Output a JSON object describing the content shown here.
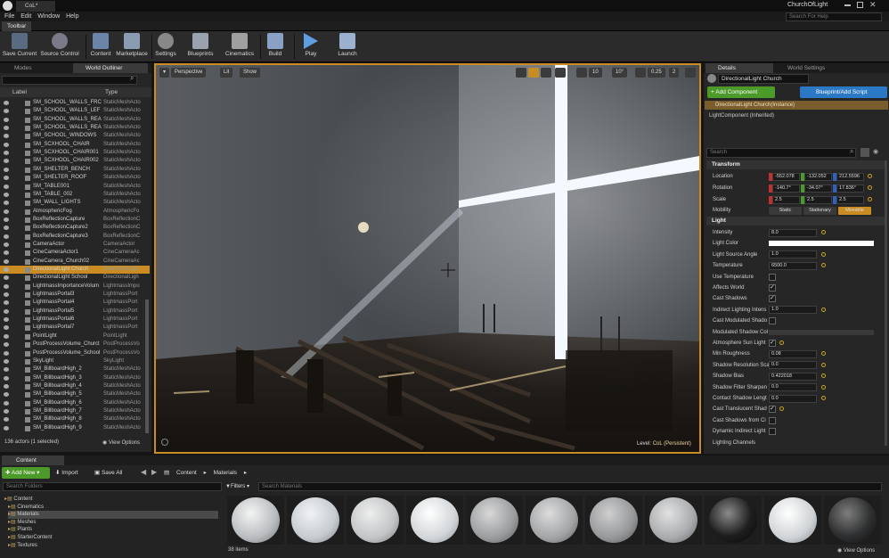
{
  "window": {
    "title": "CoL*",
    "project": "ChurchOfLight",
    "help_search_placeholder": "Search For Help"
  },
  "menu": [
    "File",
    "Edit",
    "Window",
    "Help"
  ],
  "toolbar": {
    "tab_label": "Toolbar",
    "buttons": [
      "Save Current",
      "Source Control",
      "Content",
      "Marketplace",
      "Settings",
      "Blueprints",
      "Cinematics",
      "Build",
      "Play",
      "Launch"
    ]
  },
  "left_panel": {
    "tabs": [
      "Modes",
      "World Outliner"
    ],
    "columns": {
      "label": "Label",
      "type": "Type"
    },
    "rows": [
      [
        "SM_SCHOOL_WALLS_FRC",
        "StaticMeshActo"
      ],
      [
        "SM_SCHOOL_WALLS_LEF",
        "StaticMeshActo"
      ],
      [
        "SM_SCHOOL_WALLS_REA",
        "StaticMeshActo"
      ],
      [
        "SM_SCHOOL_WALLS_REA",
        "StaticMeshActo"
      ],
      [
        "SM_SCHOOL_WINDOWS",
        "StaticMeshActo"
      ],
      [
        "SM_SCXHOOL_CHAIR",
        "StaticMeshActo"
      ],
      [
        "SM_SCXHOOL_CHAIR001",
        "StaticMeshActo"
      ],
      [
        "SM_SCXHOOL_CHAIR002",
        "StaticMeshActo"
      ],
      [
        "SM_SHELTER_BENCH",
        "StaticMeshActo"
      ],
      [
        "SM_SHELTER_ROOF",
        "StaticMeshActo"
      ],
      [
        "SM_TABLE001",
        "StaticMeshActo"
      ],
      [
        "SM_TABLE_002",
        "StaticMeshActo"
      ],
      [
        "SM_WALL_LIGHTS",
        "StaticMeshActo"
      ],
      [
        "AtmosphericFog",
        "AtmosphericFo"
      ],
      [
        "BoxReflectionCapture",
        "BoxReflectionC"
      ],
      [
        "BoxReflectionCapture2",
        "BoxReflectionC"
      ],
      [
        "BoxReflectionCapture3",
        "BoxReflectionC"
      ],
      [
        "CameraActor",
        "CameraActor"
      ],
      [
        "CineCameraActor1",
        "CineCameraAc"
      ],
      [
        "CineCamera_Church02",
        "CineCameraAc"
      ],
      [
        "DirectionalLight Church",
        "DirectionalLigh"
      ],
      [
        "DirectionalLight School",
        "DirectionalLigh"
      ],
      [
        "LightmassImportanceVolum",
        "LightmassImpo"
      ],
      [
        "LightmassPortal3",
        "LightmassPort"
      ],
      [
        "LightmassPortal4",
        "LightmassPort"
      ],
      [
        "LightmassPortal5",
        "LightmassPort"
      ],
      [
        "LightmassPortal6",
        "LightmassPort"
      ],
      [
        "LightmassPortal7",
        "LightmassPort"
      ],
      [
        "PointLight",
        "PointLight"
      ],
      [
        "PostProcessVolume_Churct",
        "PostProcessVo"
      ],
      [
        "PostProcessVolume_School",
        "PostProcessVo"
      ],
      [
        "SkyLight",
        "SkyLight"
      ],
      [
        "SM_BillboardHigh_2",
        "StaticMeshActo"
      ],
      [
        "SM_BillboardHigh_3",
        "StaticMeshActo"
      ],
      [
        "SM_BillboardHigh_4",
        "StaticMeshActo"
      ],
      [
        "SM_BillboardHigh_5",
        "StaticMeshActo"
      ],
      [
        "SM_BillboardHigh_6",
        "StaticMeshActo"
      ],
      [
        "SM_BillboardHigh_7",
        "StaticMeshActo"
      ],
      [
        "SM_BillboardHigh_8",
        "StaticMeshActo"
      ],
      [
        "SM_BillboardHigh_9",
        "StaticMeshActo"
      ]
    ],
    "selected_row": 20,
    "footer_count": "136 actors (1 selected)",
    "view_options": "View Options"
  },
  "viewport": {
    "perspective": "Perspective",
    "lit": "Lit",
    "show": "Show",
    "grid_snap": "10",
    "rot_snap": "10°",
    "scale_snap": "0.25",
    "camera_speed": "2",
    "level_label": "Level:",
    "level_name": "CoL (Persistent)"
  },
  "details": {
    "tabs": [
      "Details",
      "World Settings"
    ],
    "name_value": "DirectionalLight Church",
    "add_component": "+ Add Component",
    "blueprint": "Blueprint/Add Script",
    "instance_label": "DirectionalLight Church(Instance)",
    "component_label": "LightComponent (Inherited)",
    "search_placeholder": "Search",
    "transform_header": "Transform",
    "location_label": "Location",
    "rotation_label": "Rotation",
    "scale_label": "Scale",
    "mobility_label": "Mobility",
    "location": [
      "-552.078",
      "-132.052",
      "212.5596"
    ],
    "rotation": [
      "-140.7°",
      "-34.07°",
      "17.836°"
    ],
    "scale": [
      "2.5",
      "2.5",
      "2.5"
    ],
    "mobility": [
      "Static",
      "Stationary",
      "Movable"
    ],
    "light_header": "Light",
    "props": [
      {
        "label": "Intensity",
        "kind": "num",
        "value": "8.0"
      },
      {
        "label": "Light Color",
        "kind": "color",
        "value": ""
      },
      {
        "label": "Light Source Angle",
        "kind": "num",
        "value": "1.0"
      },
      {
        "label": "Temperature",
        "kind": "num",
        "value": "6500.0"
      },
      {
        "label": "Use Temperature",
        "kind": "cb",
        "value": false
      },
      {
        "label": "Affects World",
        "kind": "cb",
        "value": true
      },
      {
        "label": "Cast Shadows",
        "kind": "cb",
        "value": true
      },
      {
        "label": "Indirect Lighting Intens",
        "kind": "num",
        "value": "1.0"
      },
      {
        "label": "Cast Modulated Shado",
        "kind": "cb",
        "value": false
      },
      {
        "label": "Modulated Shadow Col",
        "kind": "color",
        "value": ""
      },
      {
        "label": "Atmosphere Sun Light",
        "kind": "cb",
        "value": true
      },
      {
        "label": "Min Roughness",
        "kind": "num",
        "value": "0.08"
      },
      {
        "label": "Shadow Resolution Sca",
        "kind": "num",
        "value": "0.0"
      },
      {
        "label": "Shadow Bias",
        "kind": "num",
        "value": "0.422018"
      },
      {
        "label": "Shadow Filter Sharpen",
        "kind": "num",
        "value": "0.0"
      },
      {
        "label": "Contact Shadow Lengt",
        "kind": "num",
        "value": "0.0"
      },
      {
        "label": "Cast Translucent Shad",
        "kind": "cb",
        "value": true
      },
      {
        "label": "Cast Shadows from Ci",
        "kind": "cb",
        "value": false
      },
      {
        "label": "Dynamic Indirect Light",
        "kind": "cb",
        "value": false
      },
      {
        "label": "Lighting Channels",
        "kind": "header",
        "value": ""
      }
    ]
  },
  "content_browser": {
    "tab": "Content Browser",
    "add_new": "Add New",
    "import": "Import",
    "save_all": "Save All",
    "path": [
      "Content",
      "Materials"
    ],
    "search_folders": "Search Folders",
    "filters": "Filters",
    "search_materials": "Search Materials",
    "folders": [
      "Content",
      "Cinematics",
      "Materials",
      "Meshes",
      "Plants",
      "StarterContent",
      "Textures"
    ],
    "items_count": "38 items",
    "view_options": "View Options"
  },
  "colors": {
    "accent": "#c98c23",
    "add_component": "#4c9a2a",
    "blueprint": "#2b78c5",
    "selection": "#c98c23"
  }
}
